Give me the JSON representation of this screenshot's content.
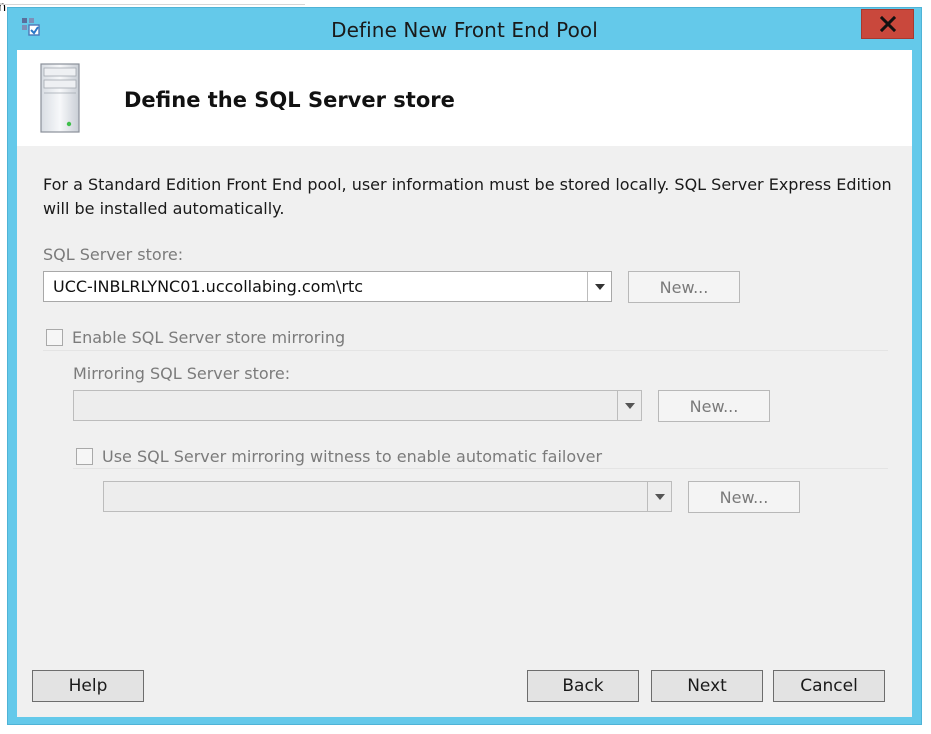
{
  "background": {
    "fragment_text": "n"
  },
  "window": {
    "title": "Define New Front End Pool",
    "accent_color": "#64c9ea",
    "close_color": "#c9483c",
    "close_glyph": "✖"
  },
  "header": {
    "title": "Define the SQL Server store",
    "icon": "server-tower-icon"
  },
  "description": "For a Standard Edition Front End pool, user information must be stored locally.  SQL Server Express Edition will be installed automatically.",
  "sql_store": {
    "label": "SQL Server store:",
    "value": "UCC-INBLRLYNC01.uccollabing.com\\rtc",
    "new_label": "New..."
  },
  "mirroring": {
    "checkbox_label": "Enable SQL Server store mirroring",
    "checked": false,
    "store_label": "Mirroring SQL Server store:",
    "store_value": "",
    "new_label": "New..."
  },
  "witness": {
    "checkbox_label": "Use SQL Server mirroring witness to enable automatic failover",
    "checked": false,
    "value": "",
    "new_label": "New..."
  },
  "footer": {
    "help_label": "Help",
    "back_label": "Back",
    "next_label": "Next",
    "cancel_label": "Cancel"
  }
}
